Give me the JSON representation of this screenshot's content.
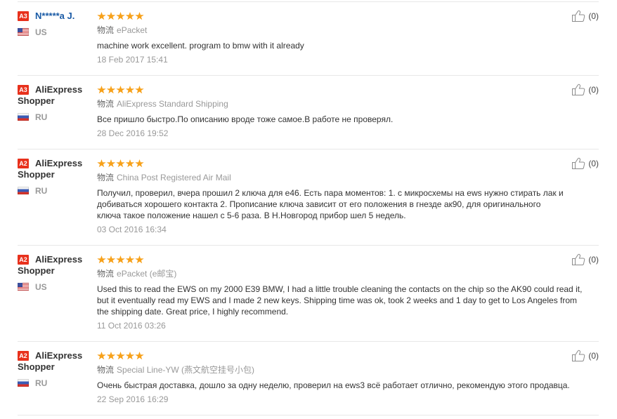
{
  "labels": {
    "logistics": "物流"
  },
  "colors": {
    "badge": "#e8311c",
    "star": "#f7a11a",
    "divider": "#e8e8e8",
    "text": "#333333",
    "muted": "#999999",
    "icon": "#8c8c8c"
  },
  "icons": {
    "helpful": "thumbs-up-icon",
    "rating": "star-icon"
  },
  "reviews": [
    {
      "level": "A3",
      "name": "N*****a J.",
      "name_color": "#1a5ba6",
      "country": "US",
      "rating": 5,
      "rating_max": 5,
      "shipping": "ePacket",
      "text": [
        "machine work excellent. program to bmw with it already"
      ],
      "date": "18 Feb 2017 15:41",
      "likes": "(0)"
    },
    {
      "level": "A3",
      "name": "AliExpress Shopper",
      "name_color": "#333333",
      "country": "RU",
      "rating": 5,
      "rating_max": 5,
      "shipping": "AliExpress Standard Shipping",
      "text": [
        "Все пришло быстро.По описанию вроде тоже самое.В работе не проверял."
      ],
      "date": "28 Dec 2016 19:52",
      "likes": "(0)"
    },
    {
      "level": "A2",
      "name": "AliExpress Shopper",
      "name_color": "#333333",
      "country": "RU",
      "rating": 5,
      "rating_max": 5,
      "shipping": "China Post Registered Air Mail",
      "text": [
        "Получил, проверил, вчера прошил 2 ключа для е46. Есть пара моментов: 1. с микросхемы на ews нужно стирать лак и",
        "добиваться хорошего контакта 2. Прописание ключа зависит от его положения в гнезде ак90, для оригинального",
        "ключа такое положение нашел с 5-6 раза. В Н.Новгород прибор шел 5 недель."
      ],
      "date": "03 Oct 2016 16:34",
      "likes": "(0)"
    },
    {
      "level": "A2",
      "name": "AliExpress Shopper",
      "name_color": "#333333",
      "country": "US",
      "rating": 5,
      "rating_max": 5,
      "shipping": "ePacket (e邮宝)",
      "text": [
        "Used this to read the EWS on my 2000 E39 BMW, I had a little trouble cleaning the contacts on the chip so the AK90 could read it,",
        "but it eventually read my EWS and I made 2 new keys. Shipping time was ok, took 2 weeks and 1 day to get to Los Angeles from",
        "the shipping date. Great price, I highly recommend."
      ],
      "date": "11 Oct 2016 03:26",
      "likes": "(0)"
    },
    {
      "level": "A2",
      "name": "AliExpress Shopper",
      "name_color": "#333333",
      "country": "RU",
      "rating": 5,
      "rating_max": 5,
      "shipping": "Special Line-YW (燕文航空挂号小包)",
      "text": [
        "Очень быстрая доставка, дошло за одну неделю, проверил на ews3 всё работает отлично, рекомендую этого продавца."
      ],
      "date": "22 Sep 2016 16:29",
      "likes": "(0)"
    }
  ]
}
